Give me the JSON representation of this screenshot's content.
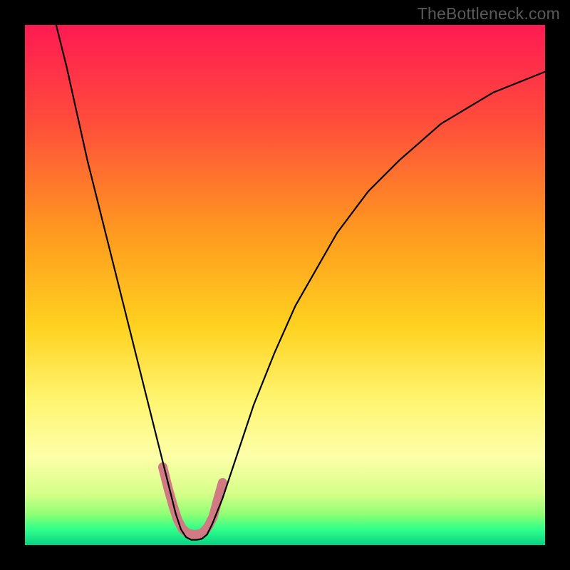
{
  "watermark": "TheBottleneck.com",
  "chart_data": {
    "type": "line",
    "title": "",
    "xlabel": "",
    "ylabel": "",
    "x_range": [
      0,
      100
    ],
    "y_range": [
      0,
      100
    ],
    "background": {
      "type": "vertical-gradient",
      "stops": [
        {
          "pct": 0,
          "color": "#ff1a52"
        },
        {
          "pct": 18,
          "color": "#ff4b3c"
        },
        {
          "pct": 40,
          "color": "#ff9a1f"
        },
        {
          "pct": 58,
          "color": "#ffd21f"
        },
        {
          "pct": 72,
          "color": "#fff570"
        },
        {
          "pct": 83,
          "color": "#fdffa8"
        },
        {
          "pct": 90,
          "color": "#d7ff8a"
        },
        {
          "pct": 94,
          "color": "#91ff74"
        },
        {
          "pct": 97,
          "color": "#2fff8a"
        },
        {
          "pct": 100,
          "color": "#09d184"
        }
      ]
    },
    "series": [
      {
        "name": "bottleneck-curve",
        "color": "#000000",
        "width": 2.2,
        "x": [
          6,
          8,
          10,
          12,
          14,
          16,
          18,
          20,
          22,
          24,
          26,
          27,
          28,
          29,
          30,
          31,
          32,
          33,
          34,
          35,
          36,
          38,
          40,
          44,
          48,
          52,
          56,
          60,
          66,
          72,
          80,
          90,
          100
        ],
        "y": [
          100,
          92,
          83,
          74,
          66,
          58,
          50,
          42,
          34,
          26,
          18,
          14,
          10,
          6,
          3,
          1.5,
          1,
          1,
          1.2,
          2,
          4,
          9,
          15,
          27,
          37,
          46,
          53,
          60,
          68,
          74,
          81,
          87,
          91
        ]
      },
      {
        "name": "highlight-band",
        "color": "#d27a84",
        "width": 13,
        "linecap": "round",
        "x": [
          26.5,
          27.5,
          28.5,
          29.3,
          30.2,
          31.2,
          32.5,
          34.0,
          35.2,
          36.2,
          37.0,
          38.0
        ],
        "y": [
          15.0,
          11.0,
          7.5,
          5.0,
          3.2,
          2.3,
          2.0,
          2.2,
          3.5,
          5.5,
          8.5,
          12.0
        ]
      }
    ]
  }
}
